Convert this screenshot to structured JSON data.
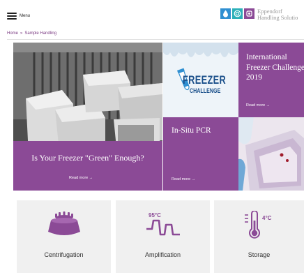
{
  "header": {
    "menu_label": "Menu",
    "brand": {
      "line1": "Eppendorf",
      "line2": "Handling Solutio"
    },
    "icons": [
      "drop-icon",
      "spiral-icon",
      "bag-icon"
    ]
  },
  "breadcrumb": {
    "items": [
      "Home",
      "»",
      "Sample Handling"
    ]
  },
  "tiles": {
    "freezer_green": {
      "title": "Is Your Freezer \"Green\" Enough?",
      "read_more": "Read more →"
    },
    "freezer_logo": {
      "line1": "FREEZER",
      "line2": "CHALLENGE"
    },
    "international": {
      "title": "International Freezer Challenge 2019",
      "read_more": "Read more →"
    },
    "insitu": {
      "title": "In-Situ PCR",
      "read_more": "Read more →"
    }
  },
  "categories": [
    {
      "label": "Centrifugation",
      "icon": "centrifuge-icon"
    },
    {
      "label": "Amplification",
      "icon": "amplification-icon",
      "icon_text": "95°C"
    },
    {
      "label": "Storage",
      "icon": "thermometer-icon",
      "icon_text": "4°C"
    }
  ],
  "colors": {
    "accent": "#8b4a96",
    "brand_blue": "#2f8fd1",
    "card_bg": "#f0f0f0"
  }
}
